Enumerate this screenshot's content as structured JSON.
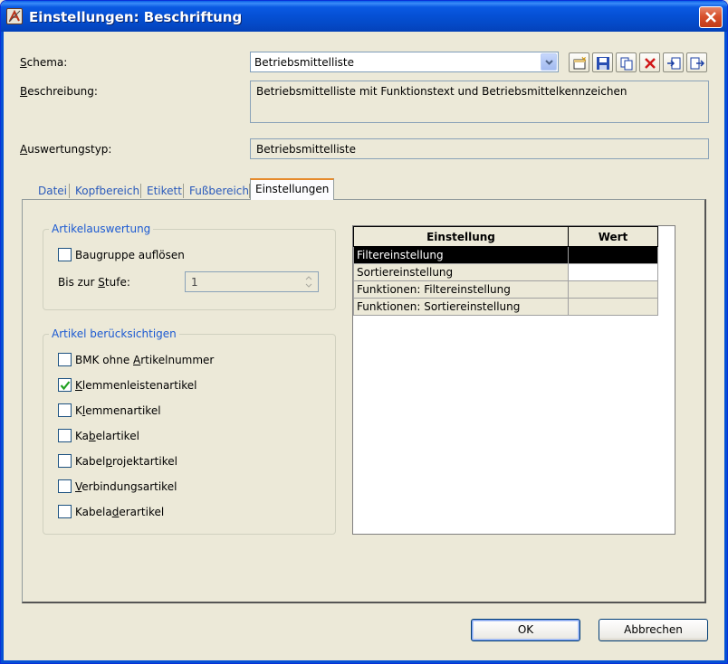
{
  "window": {
    "title": "Einstellungen: Beschriftung"
  },
  "colors": {
    "titlebar": "#0550d4",
    "group_title": "#1c5ad2",
    "tab_link": "#2a5abb",
    "tab_active_accent": "#e68b2c"
  },
  "schema": {
    "label_prefix": "S",
    "label_rest": "chema:",
    "value": "Betriebsmittelliste",
    "toolbar_icons": [
      "new-icon",
      "save-icon",
      "copy-icon",
      "delete-icon",
      "import-icon",
      "export-icon"
    ]
  },
  "beschreibung": {
    "label_prefix": "B",
    "label_rest": "eschreibung:",
    "value": "Betriebsmittelliste mit Funktionstext und Betriebsmittelkennzeichen"
  },
  "auswertungstyp": {
    "label_prefix": "A",
    "label_rest": "uswertungstyp:",
    "value": "Betriebsmittelliste"
  },
  "tabs": [
    "Datei",
    "Kopfbereich",
    "Etikett",
    "Fußbereich",
    "Einstellungen"
  ],
  "artikelauswertung": {
    "title": "Artikelauswertung",
    "baugruppe": {
      "pre": "Baugruppe auf",
      "ul": "l",
      "post": "ösen",
      "checked": false
    },
    "stufe_label": {
      "pre": "Bis zur ",
      "ul": "S",
      "post": "tufe:"
    },
    "stufe_value": "1"
  },
  "artikel_beruecksichtigen": {
    "title": "Artikel berücksichtigen",
    "items": [
      {
        "pre": "BMK ohne ",
        "ul": "A",
        "post": "rtikelnummer",
        "checked": false
      },
      {
        "pre": "",
        "ul": "K",
        "post": "lemmenleistenartikel",
        "checked": true
      },
      {
        "pre": "K",
        "ul": "l",
        "post": "emmenartikel",
        "checked": false
      },
      {
        "pre": "Ka",
        "ul": "b",
        "post": "elartikel",
        "checked": false
      },
      {
        "pre": "Kabel",
        "ul": "p",
        "post": "rojektartikel",
        "checked": false
      },
      {
        "pre": "",
        "ul": "V",
        "post": "erbindungsartikel",
        "checked": false
      },
      {
        "pre": "Kabela",
        "ul": "d",
        "post": "erartikel",
        "checked": false
      }
    ]
  },
  "settings_grid": {
    "headers": [
      "Einstellung",
      "Wert"
    ],
    "rows": [
      {
        "einstellung": "Filtereinstellung",
        "wert": ""
      },
      {
        "einstellung": "Sortiereinstellung",
        "wert": ""
      },
      {
        "einstellung": "Funktionen: Filtereinstellung",
        "wert": ""
      },
      {
        "einstellung": "Funktionen: Sortiereinstellung",
        "wert": ""
      }
    ]
  },
  "buttons": {
    "ok": "OK",
    "cancel": "Abbrechen"
  }
}
